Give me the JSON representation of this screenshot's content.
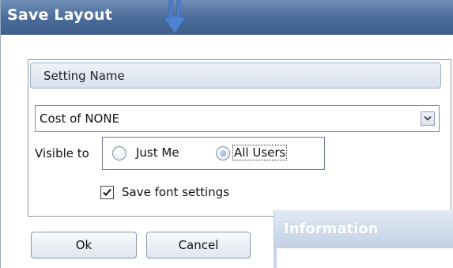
{
  "dialog": {
    "title": "Save Layout",
    "colors": {
      "titlebar": "#4a6a98",
      "title_text": "#ffffff"
    }
  },
  "settings_panel": {
    "header": "Setting Name",
    "setting_name": {
      "value": "Cost of NONE",
      "dropdown_icon": "chevron-down-icon"
    },
    "visible_to": {
      "label": "Visible to",
      "options": [
        {
          "label": "Just Me",
          "selected": false
        },
        {
          "label": "All Users",
          "selected": true
        }
      ]
    },
    "save_font_settings": {
      "label": "Save font settings",
      "checked": true
    }
  },
  "buttons": {
    "ok": "Ok",
    "cancel": "Cancel"
  },
  "info_window": {
    "title": "Information"
  }
}
